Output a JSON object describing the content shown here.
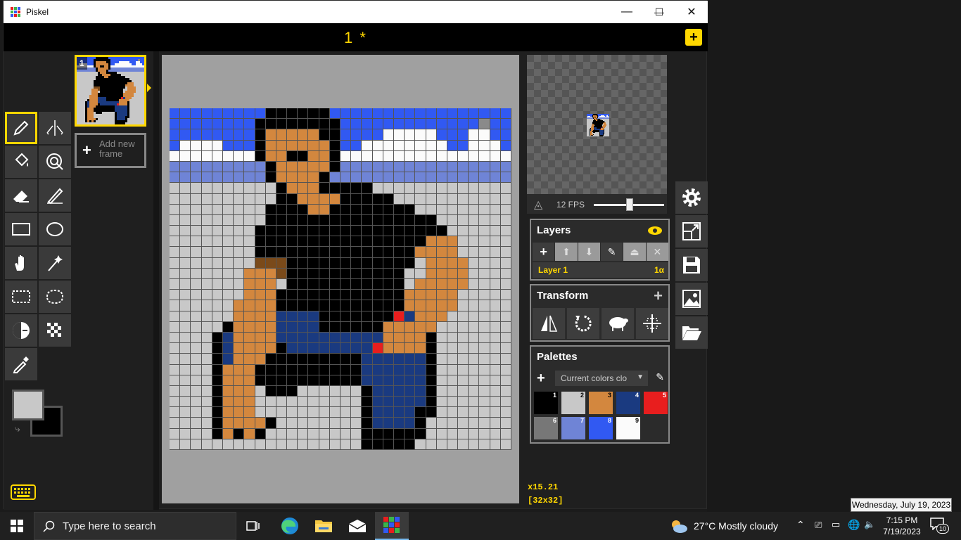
{
  "window": {
    "app_title": "Piskel",
    "minimize": "—",
    "maximize": "☐",
    "close": "✕"
  },
  "document": {
    "title": "1 *",
    "add_icon": "plus-icon"
  },
  "frames": {
    "frame_number": "1",
    "add_new_frame": "Add new frame"
  },
  "preview": {
    "fps_label": "12 FPS",
    "fps_value": 12
  },
  "layers": {
    "title": "Layers",
    "layer_name": "Layer 1",
    "layer_alpha": "1α"
  },
  "transform": {
    "title": "Transform"
  },
  "palettes": {
    "title": "Palettes",
    "selected_palette": "Current colors clo",
    "colors": [
      {
        "n": "1",
        "hex": "#000000"
      },
      {
        "n": "2",
        "hex": "#c8c8c8"
      },
      {
        "n": "3",
        "hex": "#d3873e"
      },
      {
        "n": "4",
        "hex": "#1a3a80"
      },
      {
        "n": "5",
        "hex": "#e81e1e"
      },
      {
        "n": "6",
        "hex": "#777777"
      },
      {
        "n": "7",
        "hex": "#6f84d6"
      },
      {
        "n": "8",
        "hex": "#3159f2"
      },
      {
        "n": "9",
        "hex": "#fbfbfb"
      }
    ]
  },
  "status": {
    "cursor": "x15.21",
    "size": "[32x32]"
  },
  "colors": {
    "primary": "#c8c8c8",
    "secondary": "#000000",
    "accent": "#ffd700"
  },
  "taskbar": {
    "search_placeholder": "Type here to search",
    "weather": "27°C  Mostly cloudy",
    "time": "7:15 PM",
    "date": "7/19/2023",
    "notifications": "10",
    "tooltip": "Wednesday, July 19, 2023"
  },
  "sprite": {
    "palette": {
      "B": "#3159f2",
      "W": "#fbfbfb",
      "G": "#c8c8c8",
      "P": "#6f84d6",
      "K": "#000000",
      "S": "#d3873e",
      "N": "#1a3a80",
      "R": "#e81e1e",
      "M": "#7a4a1a",
      "H": "#8a8a8a"
    },
    "rows": [
      "BBBBBBBBBKKKKKKBBBBBBBBBBBBBBBBB",
      "BBBBBBBBKKKKKKKKBBBBBBBBBBBBBHBB",
      "BBBBBBBBKSSSSSKKBBBBWWWWWBBBWWBB",
      "BWWWWBBBKSSSSSSKBBWWWWWWWWBBWWWB",
      "WWWWWWWWKSSKKSSKWWWWWWWWWWWWWWWW",
      "PPPPPPPPPKSSSSSKPPPPPPPPPPPPPPPP",
      "PPPPPPPPPKSSSSKPPPPPPPPPPPPPPPPP",
      "GGGGGGGGGGKSSSKKKKKGGGGGGGGGGGGG",
      "GGGGGGGGGGKKSSSSKKKKKGGGGGGGGGGG",
      "GGGGGGGGGKKKKSSKKKKKKKKGGGGGGGGG",
      "GGGGGGGGGKKKKKKKKKKKKKKKKGGGGGGG",
      "GGGGGGGGKKKKKKKKKKKKKKKKKKGGGGGG",
      "GGGGGGGGKKKKKKKKKKKKKKKKSSSGGGGG",
      "GGGGGGGGKKKKKKKKKKKKKKKSSSSGGGGG",
      "GGGGGGGGMMMKKKKKKKKKKKKGSSSSGGGG",
      "GGGGGGGSSSMKKKKKKKKKKKGGSSSSGGGG",
      "GGGGGGGSSSGKKKKKKKKKKKGSSSSSGGGG",
      "GGGGGGGSSSKKKKKKKKKKKKSSSSSGGGGG",
      "GGGGGGSSSSKKKKKKKKKKKKSSSSSGGGGG",
      "GGGGGGSSSSNNNNKKKKKKKRNSSSGGGGGG",
      "GGGGGKSSSSNNNNKKKKKKSSSSSGGGGGGG",
      "GGGGKNSSSSNNNNNNNNNNSSSSKGGGGGGG",
      "GGGGKNSSSSKNNNNNNNNRSSSSKGGGGGGG",
      "GGGGKNSSSKKKKKKKKKNNNNNNKGGGGGGG",
      "GGGGKSSSKKKKKKKKKKNNNNNNKGGGGGGG",
      "GGGGKSSSKKKKKKKKKKNNNNNNKGGGGGGG",
      "GGGGKSSSGKKKGGGGGGKNNNNNKGGGGGGG",
      "GGGGKSSSGGGGGGGGGGKNNNNNKGGGGGGG",
      "GGGGKSSSGGGGGGGGGGKNNNNKKGGGGGGG",
      "GGGGKSSSSKGGGGGGGGKNNNNKGGGGGGGG",
      "GGGGKSKSKGGGGGGGGGKKKKKKGGGGGGGG",
      "GGGGGGGGGGGGGGGGGGKKKKKGGGGGGGGG"
    ]
  }
}
